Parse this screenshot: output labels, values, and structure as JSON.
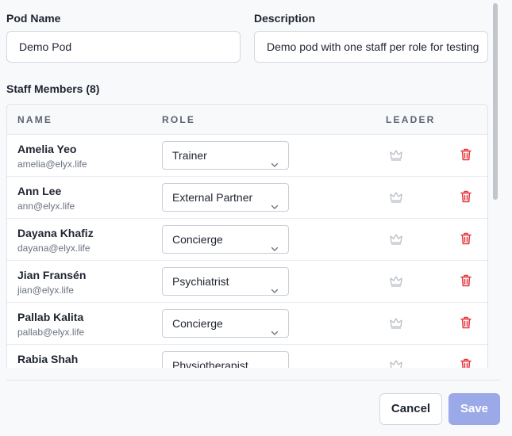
{
  "form": {
    "pod_name_label": "Pod Name",
    "pod_name_value": "Demo Pod",
    "description_label": "Description",
    "description_value": "Demo pod with one staff per role for testing"
  },
  "staff": {
    "title": "Staff Members (8)",
    "columns": {
      "name": "NAME",
      "role": "ROLE",
      "leader": "LEADER"
    },
    "members": [
      {
        "name": "Amelia Yeo",
        "email": "amelia@elyx.life",
        "role": "Trainer"
      },
      {
        "name": "Ann Lee",
        "email": "ann@elyx.life",
        "role": "External Partner"
      },
      {
        "name": "Dayana Khafiz",
        "email": "dayana@elyx.life",
        "role": "Concierge"
      },
      {
        "name": "Jian Fransén",
        "email": "jian@elyx.life",
        "role": "Psychiatrist"
      },
      {
        "name": "Pallab Kalita",
        "email": "pallab@elyx.life",
        "role": "Concierge"
      },
      {
        "name": "Rabia Shah",
        "email": "",
        "role": "Physiotherapist"
      }
    ]
  },
  "footer": {
    "cancel_label": "Cancel",
    "save_label": "Save"
  },
  "icons": {
    "leader": "crown-icon",
    "delete": "trash-icon",
    "dropdown": "chevron-down-icon"
  },
  "colors": {
    "delete": "#e5363b",
    "save_disabled": "#9ca9e8",
    "crown": "#b9bec7"
  }
}
